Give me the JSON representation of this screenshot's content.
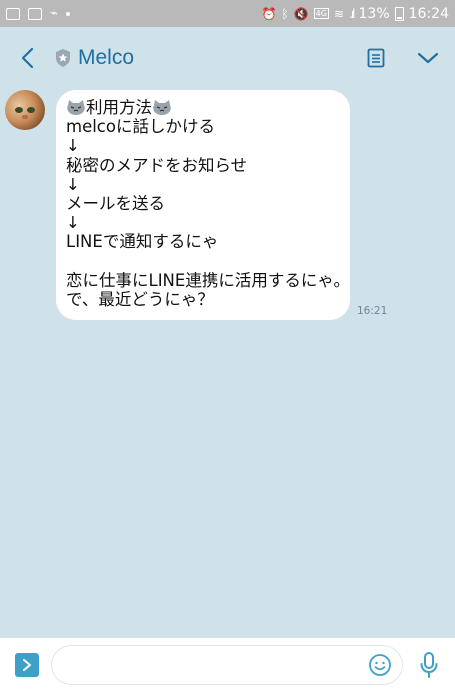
{
  "status_bar": {
    "battery": "13%",
    "time": "16:24"
  },
  "header": {
    "title": "Melco"
  },
  "message": {
    "lines": [
      "利用方法",
      "melcoに話しかける",
      "↓",
      "秘密のメアドをお知らせ",
      "↓",
      "メールを送る",
      "↓",
      "LINEで通知するにゃ",
      "",
      "恋に仕事にLINE連携に活用するにゃ。",
      "で、最近どうにゃ？"
    ],
    "time": "16:21"
  },
  "composer": {
    "value": "",
    "placeholder": ""
  },
  "colors": {
    "accent": "#1f6fa3",
    "background": "#cfe1e9",
    "expand": "#3fa0c7"
  }
}
